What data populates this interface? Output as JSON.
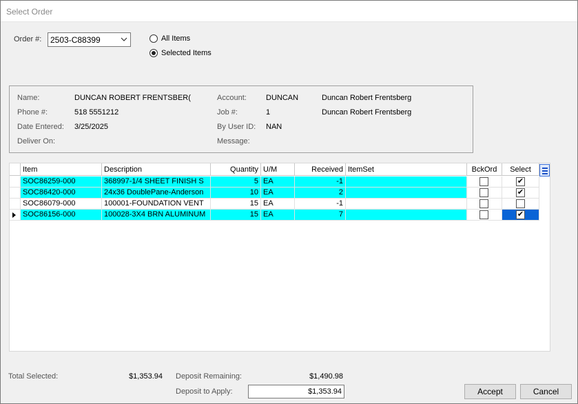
{
  "window": {
    "title": "Select Order"
  },
  "order": {
    "label": "Order #:",
    "value": "2503-C88399",
    "radio_all": "All Items",
    "radio_selected": "Selected Items",
    "selected_option": "Selected Items"
  },
  "info": {
    "name_label": "Name:",
    "name_value": "DUNCAN ROBERT FRENTSBER(",
    "phone_label": "Phone #:",
    "phone_value": "518 5551212",
    "date_label": "Date Entered:",
    "date_value": "3/25/2025",
    "deliver_label": "Deliver On:",
    "account_label": "Account:",
    "account_value": "DUNCAN",
    "account_name": "Duncan Robert Frentsberg",
    "job_label": "Job #:",
    "job_value": "1",
    "job_name": "Duncan Robert Frentsberg",
    "byuser_label": "By User ID:",
    "byuser_value": "NAN",
    "message_label": "Message:"
  },
  "grid": {
    "columns": [
      "Item",
      "Description",
      "Quantity",
      "U/M",
      "Received",
      "ItemSet",
      "BckOrd",
      "Select"
    ],
    "rows": [
      {
        "item": "SOC86259-000",
        "description": "368997-1/4 SHEET FINISH S",
        "quantity": "5",
        "um": "EA",
        "received": "-1",
        "itemset": "",
        "bckord": false,
        "select": true,
        "highlighted": true,
        "current": false
      },
      {
        "item": "SOC86420-000",
        "description": "24x36 DoublePane-Anderson",
        "quantity": "10",
        "um": "EA",
        "received": "2",
        "itemset": "",
        "bckord": false,
        "select": true,
        "highlighted": true,
        "current": false
      },
      {
        "item": "SOC86079-000",
        "description": "100001-FOUNDATION VENT",
        "quantity": "15",
        "um": "EA",
        "received": "-1",
        "itemset": "",
        "bckord": false,
        "select": false,
        "highlighted": false,
        "current": false
      },
      {
        "item": "SOC86156-000",
        "description": "100028-3X4 BRN ALUMINUM",
        "quantity": "15",
        "um": "EA",
        "received": "7",
        "itemset": "",
        "bckord": false,
        "select": true,
        "highlighted": true,
        "current": true
      }
    ]
  },
  "totals": {
    "total_selected_label": "Total Selected:",
    "total_selected_value": "$1,353.94",
    "deposit_remaining_label": "Deposit Remaining:",
    "deposit_remaining_value": "$1,490.98",
    "deposit_apply_label": "Deposit to Apply:",
    "deposit_apply_value": "$1,353.94"
  },
  "buttons": {
    "accept": "Accept",
    "cancel": "Cancel"
  },
  "colors": {
    "row_highlight": "#00ffff",
    "selection": "#0a64d6"
  }
}
